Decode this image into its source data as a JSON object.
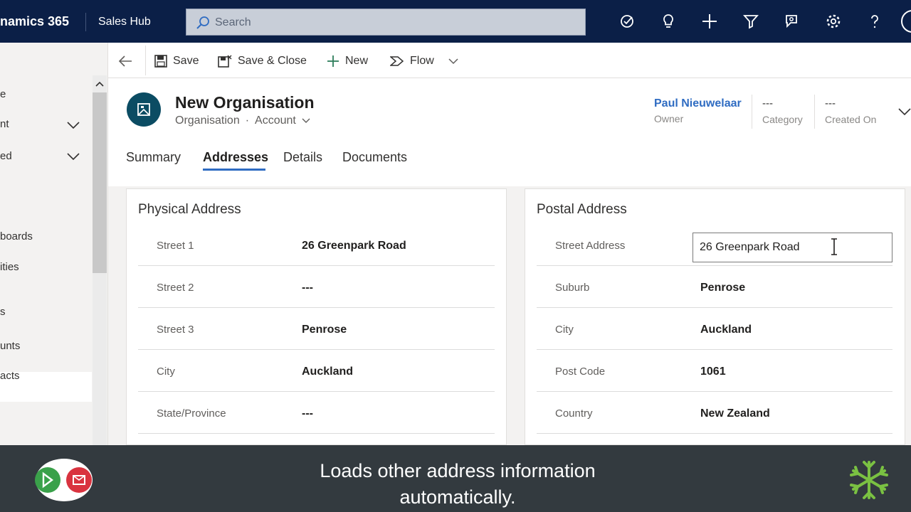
{
  "topbar": {
    "brand": "namics 365",
    "app_name": "Sales Hub",
    "search_placeholder": "Search",
    "icons": [
      "task-check-icon",
      "lightbulb-icon",
      "plus-icon",
      "filter-icon",
      "assistant-icon",
      "gear-icon",
      "help-icon",
      "avatar-icon"
    ]
  },
  "leftnav": {
    "items": [
      "e",
      "nt",
      "ed",
      "boards",
      "ities",
      "s",
      "unts",
      "acts"
    ],
    "selected": "unts"
  },
  "commands": {
    "save": "Save",
    "save_close": "Save & Close",
    "new": "New",
    "flow": "Flow"
  },
  "record": {
    "title": "New Organisation",
    "entity": "Organisation",
    "separator": "·",
    "form": "Account",
    "owner_name": "Paul Nieuwelaar",
    "owner_label": "Owner",
    "category_value": "---",
    "category_label": "Category",
    "created_value": "---",
    "created_label": "Created On"
  },
  "tabs": [
    "Summary",
    "Addresses",
    "Details",
    "Documents"
  ],
  "active_tab": "Addresses",
  "physical": {
    "title": "Physical Address",
    "rows": [
      {
        "label": "Street 1",
        "value": "26 Greenpark Road"
      },
      {
        "label": "Street 2",
        "value": "---"
      },
      {
        "label": "Street 3",
        "value": "Penrose"
      },
      {
        "label": "City",
        "value": "Auckland"
      },
      {
        "label": "State/Province",
        "value": "---"
      }
    ]
  },
  "postal": {
    "title": "Postal Address",
    "street_label": "Street Address",
    "street_value": "26 Greenpark Road",
    "rows": [
      {
        "label": "Suburb",
        "value": "Penrose"
      },
      {
        "label": "City",
        "value": "Auckland"
      },
      {
        "label": "Post Code",
        "value": "1061"
      },
      {
        "label": "Country",
        "value": "New Zealand"
      }
    ]
  },
  "caption": {
    "line1": "Loads other address information",
    "line2": "automatically."
  },
  "colors": {
    "topbar": "#0b1f47",
    "accent": "#2f6cc2",
    "caption_bg": "#333a3f",
    "record_icon": "#0b4c63"
  }
}
